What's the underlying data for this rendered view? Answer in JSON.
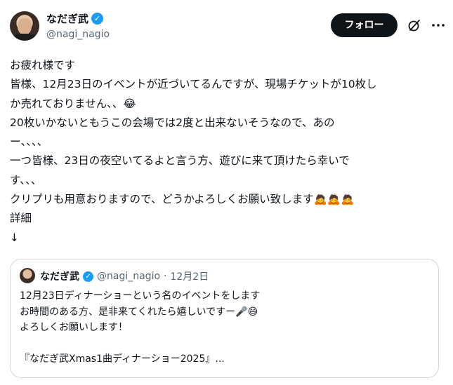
{
  "author": {
    "display_name": "なだぎ武",
    "handle": "@nagi_nagio",
    "verified_icon": "verified-badge-icon"
  },
  "actions": {
    "follow_label": "フォロー",
    "grok_icon": "grok-icon",
    "more_icon": "more-icon"
  },
  "post": {
    "lines": [
      "お疲れ様です",
      "皆様、12月23日のイベントが近づいてるんですが、現場チケットが10枚し",
      "か売れておりません、、😂",
      "20枚いかないともうこの会場では2度と出来ないそうなので、あの",
      "ー、、、、",
      "一つ皆様、23日の夜空いてるよと言う方、遊びに来て頂けたら幸いで",
      "す、、、",
      "クリプリも用意おりますので、どうかよろしくお願い致します🙇🙇🙇",
      "詳細",
      "↓"
    ]
  },
  "quote": {
    "display_name": "なだぎ武",
    "handle": "@nagi_nagio",
    "separator": "·",
    "date": "12月2日",
    "lines": [
      "12月23日ディナーショーという名のイベントをします",
      "お時間のある方、是非来てくれたら嬉しいですー🎤😄",
      "よろしくお願いします！",
      "",
      "『なだぎ武Xmas1曲ディナーショー2025』..."
    ]
  }
}
